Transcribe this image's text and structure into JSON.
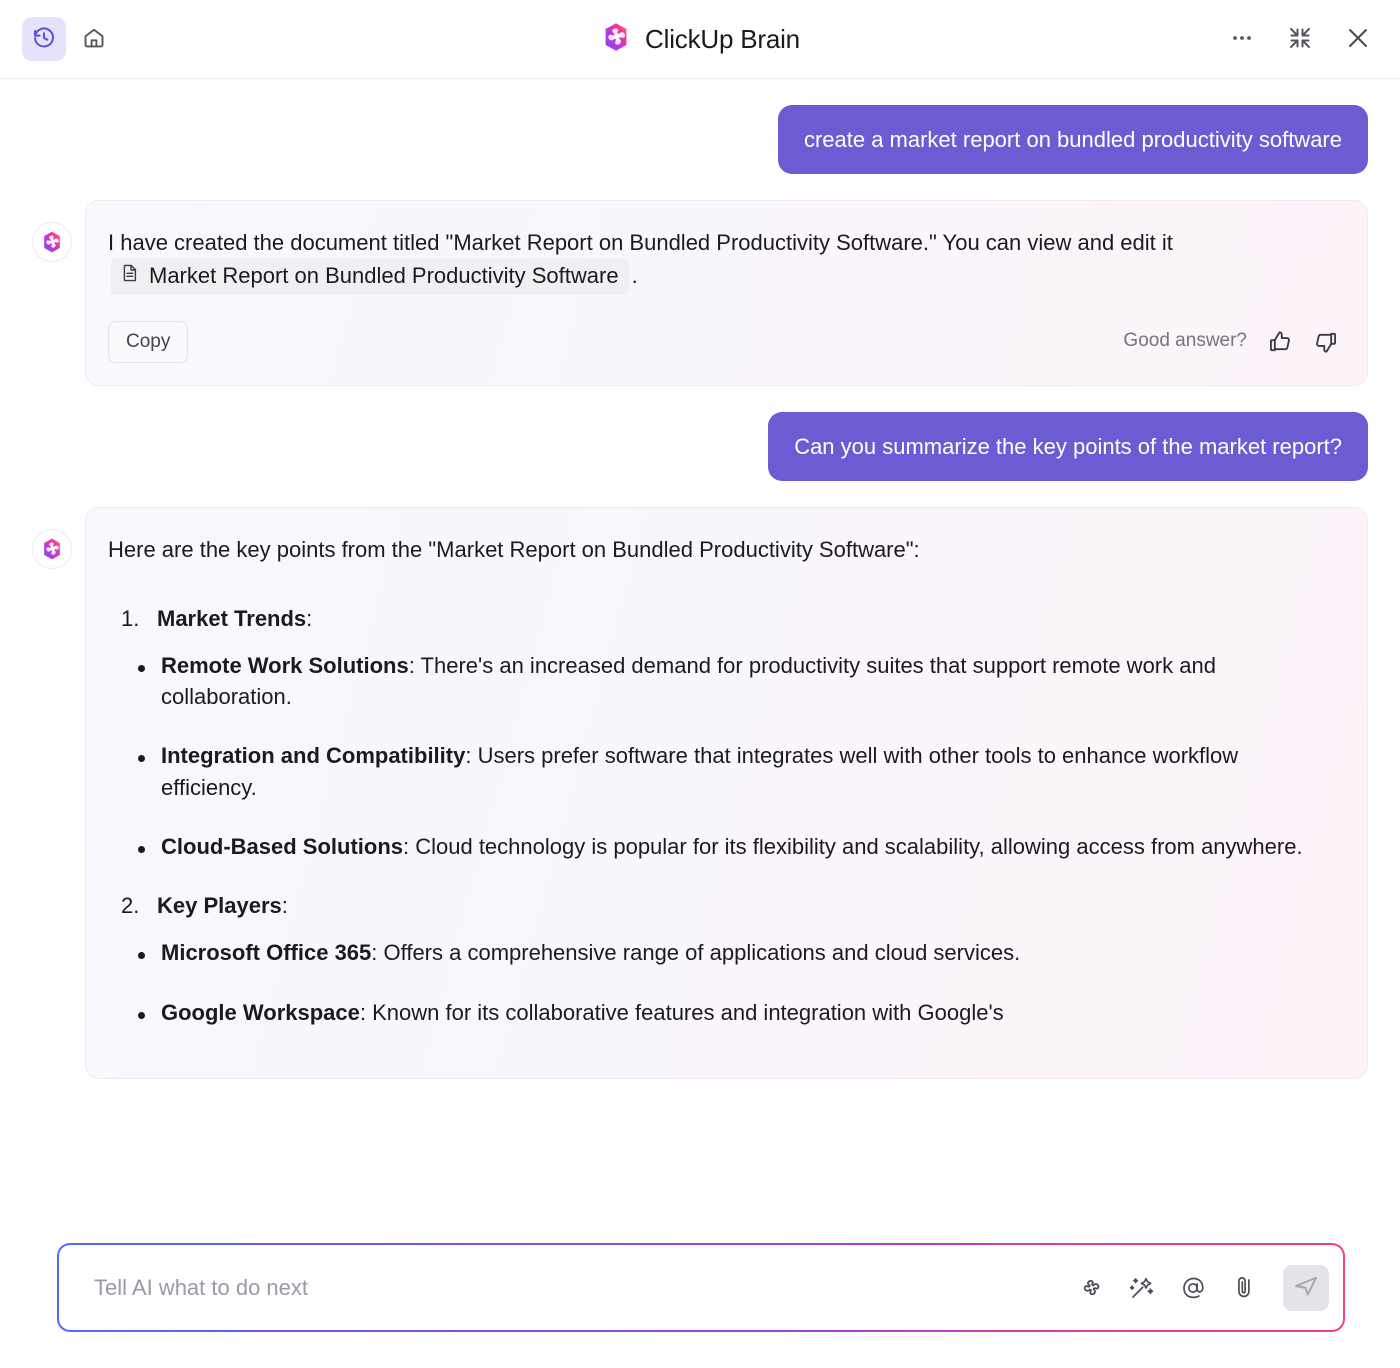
{
  "header": {
    "title": "ClickUp Brain",
    "logo_icon": "clickup-brain-logo",
    "history_icon": "history-clock-icon",
    "home_icon": "home-icon",
    "more_icon": "ellipsis-icon",
    "collapse_icon": "collapse-icon",
    "close_icon": "close-icon",
    "accent_color": "#6c5cd4",
    "history_button_bg": "#e5e3fb"
  },
  "messages": [
    {
      "role": "user",
      "text": "create a market report on bundled productivity software"
    },
    {
      "role": "ai",
      "text_before": "I have created the document titled \"Market Report on Bundled Productivity Software.\" You can view and edit it",
      "doc_chip": "Market Report on Bundled Productivity Software",
      "doc_icon": "document-icon",
      "text_after": ".",
      "copy_label": "Copy",
      "feedback_label": "Good answer?",
      "thumbs_up_icon": "thumbs-up-icon",
      "thumbs_down_icon": "thumbs-down-icon"
    },
    {
      "role": "user",
      "text": "Can you summarize the key points of the market report?"
    },
    {
      "role": "ai",
      "intro": "Here are the key points from the \"Market Report on Bundled Productivity Software\":",
      "sections": [
        {
          "number": "1.",
          "heading": "Market Trends",
          "heading_suffix": ":",
          "bullets": [
            {
              "term": "Remote Work Solutions",
              "desc": ": There's an increased demand for productivity suites that support remote work and collaboration."
            },
            {
              "term": "Integration and Compatibility",
              "desc": ": Users prefer software that integrates well with other tools to enhance workflow efficiency."
            },
            {
              "term": "Cloud-Based Solutions",
              "desc": ": Cloud technology is popular for its flexibility and scalability, allowing access from anywhere."
            }
          ]
        },
        {
          "number": "2.",
          "heading": "Key Players",
          "heading_suffix": ":",
          "bullets": [
            {
              "term": "Microsoft Office 365",
              "desc": ": Offers a comprehensive range of applications and cloud services."
            },
            {
              "term": "Google Workspace",
              "desc": ": Known for its collaborative features and integration with Google's"
            }
          ]
        }
      ]
    }
  ],
  "composer": {
    "placeholder": "Tell AI what to do next",
    "value": "",
    "brain_icon": "brain-outline-icon",
    "magic_icon": "magic-wand-icon",
    "mention_icon": "at-mention-icon",
    "attach_icon": "paperclip-icon",
    "send_icon": "send-arrow-icon"
  }
}
